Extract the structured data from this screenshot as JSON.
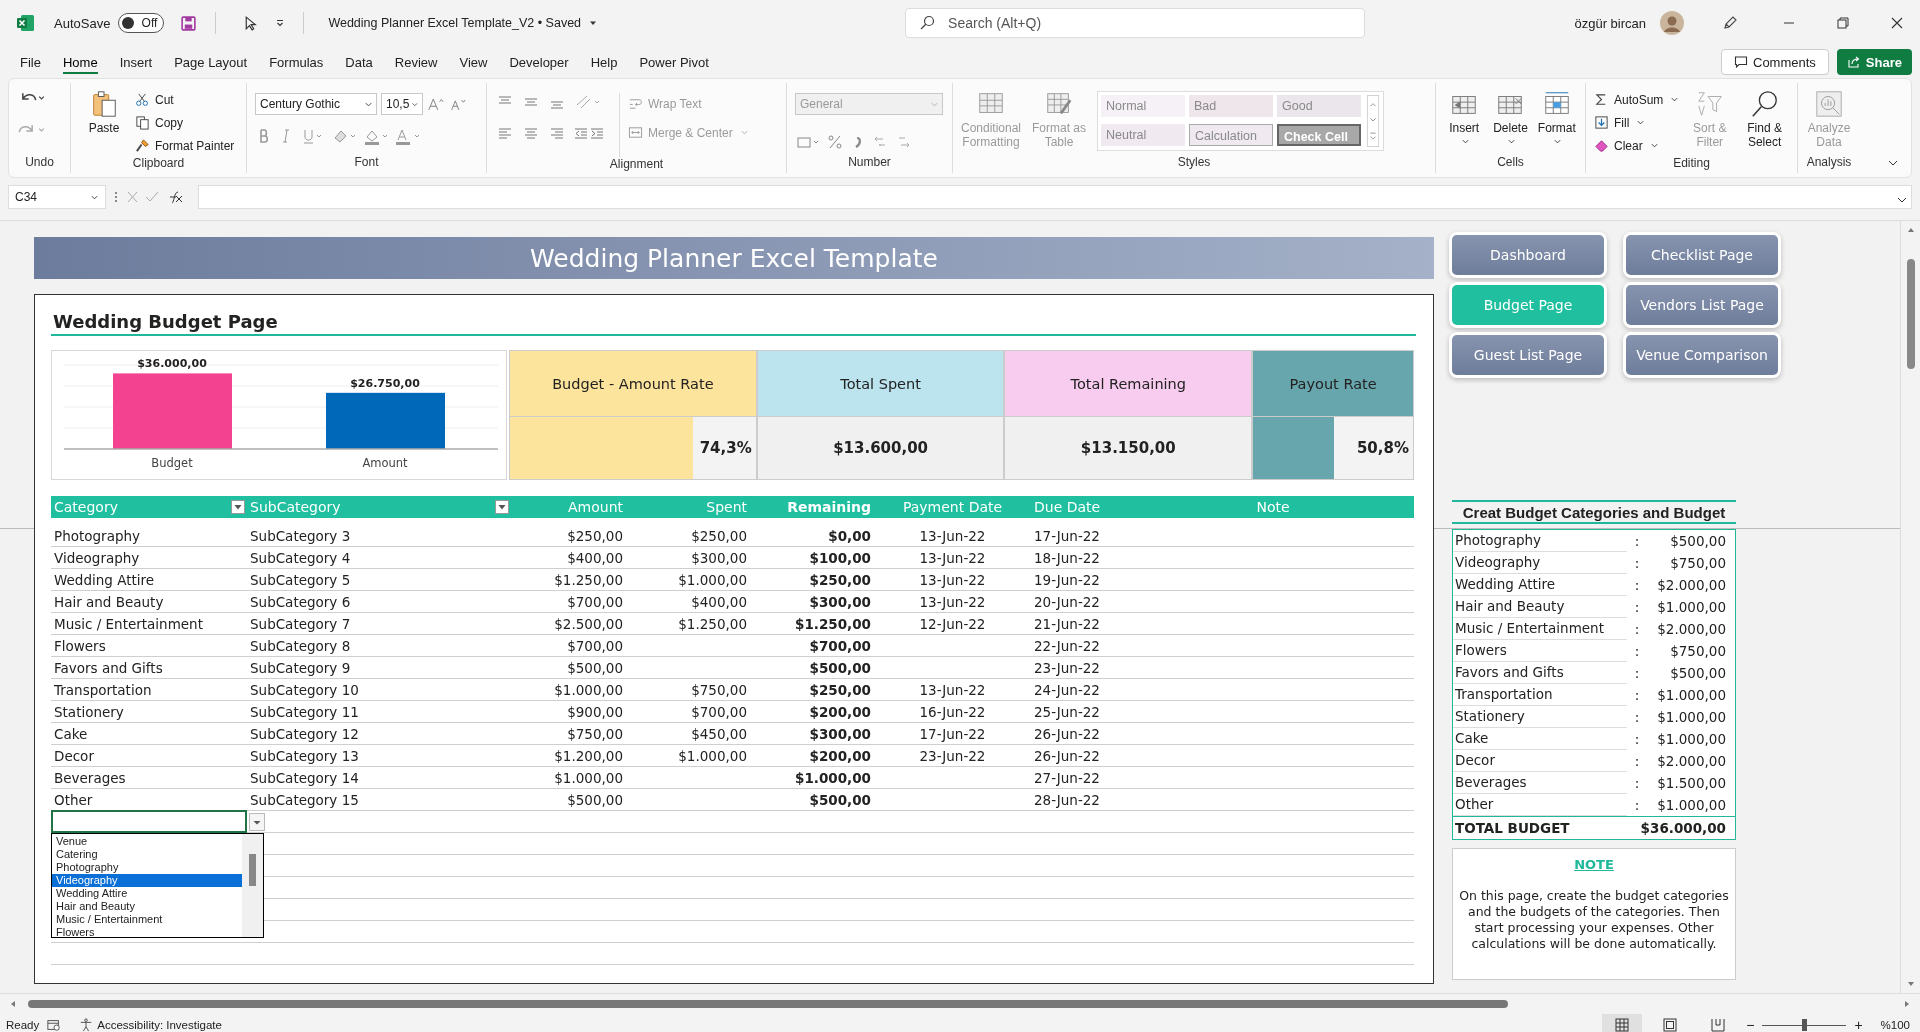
{
  "title_bar": {
    "autosave": {
      "label": "AutoSave",
      "state": "Off",
      "on": false
    },
    "document_title": "Wedding Planner Excel Template_V2 • Saved",
    "search": {
      "placeholder": "Search (Alt+Q)"
    },
    "user_name": "özgür bircan"
  },
  "ribbon_tabs": [
    {
      "label": "File",
      "selected": false
    },
    {
      "label": "Home",
      "selected": true
    },
    {
      "label": "Insert",
      "selected": false
    },
    {
      "label": "Page Layout",
      "selected": false
    },
    {
      "label": "Formulas",
      "selected": false
    },
    {
      "label": "Data",
      "selected": false
    },
    {
      "label": "Review",
      "selected": false
    },
    {
      "label": "View",
      "selected": false
    },
    {
      "label": "Developer",
      "selected": false
    },
    {
      "label": "Help",
      "selected": false
    },
    {
      "label": "Power Pivot",
      "selected": false
    }
  ],
  "comments_button": "Comments",
  "share_button": "Share",
  "ribbon": {
    "undo": {
      "label": "Undo"
    },
    "clipboard": {
      "label": "Clipboard",
      "paste": "Paste",
      "cut": "Cut",
      "copy": "Copy",
      "format_painter": "Format Painter"
    },
    "font": {
      "label": "Font",
      "family": "Century Gothic",
      "size": "10,5"
    },
    "alignment": {
      "label": "Alignment",
      "wrap_text": {
        "label": "Wrap Text",
        "disabled": true
      },
      "merge_center": {
        "label": "Merge & Center",
        "disabled": true
      }
    },
    "number": {
      "label": "Number",
      "format": {
        "label": "General",
        "disabled": true
      }
    },
    "styles": {
      "label": "Styles",
      "conditional_formatting": {
        "label": "Conditional Formatting",
        "disabled": true
      },
      "format_as_table": {
        "label": "Format as Table",
        "disabled": true
      },
      "cell_styles": [
        {
          "label": "Normal",
          "kind": "normal"
        },
        {
          "label": "Bad",
          "kind": "bad"
        },
        {
          "label": "Good",
          "kind": "good"
        },
        {
          "label": "Neutral",
          "kind": "neutral"
        },
        {
          "label": "Calculation",
          "kind": "calculation"
        },
        {
          "label": "Check Cell",
          "kind": "check"
        }
      ]
    },
    "cells": {
      "label": "Cells",
      "buttons": [
        "Insert",
        "Delete",
        "Format"
      ]
    },
    "editing": {
      "label": "Editing",
      "autosum": {
        "label": "AutoSum",
        "disabled": false
      },
      "fill": {
        "label": "Fill",
        "disabled": false
      },
      "clear": {
        "label": "Clear",
        "disabled": false
      },
      "sort_filter": {
        "label": "Sort & Filter",
        "disabled": true
      },
      "find_select": {
        "label": "Find & Select",
        "disabled": false
      }
    },
    "analysis": {
      "label": "Analysis",
      "analyze_data": {
        "label": "Analyze Data",
        "disabled": true
      }
    }
  },
  "formula_bar": {
    "name_box": "C34"
  },
  "sheet": {
    "banner_title": "Wedding Planner Excel Template",
    "nav_buttons": [
      {
        "label": "Dashboard",
        "selected": false
      },
      {
        "label": "Checklist Page",
        "selected": false
      },
      {
        "label": "Budget Page",
        "selected": true
      },
      {
        "label": "Vendors List Page",
        "selected": false
      },
      {
        "label": "Guest List Page",
        "selected": false
      },
      {
        "label": "Venue Comparison",
        "selected": false
      }
    ],
    "section_title": "Wedding Budget Page",
    "budget_chart": {
      "chart_data": {
        "type": "bar",
        "categories": [
          "Budget",
          "Amount"
        ],
        "values": [
          36000,
          26750
        ],
        "colors": [
          "#f3428f",
          "#0068b8"
        ],
        "value_labels": [
          "$36.000,00",
          "$26.750,00"
        ]
      }
    },
    "kpis": [
      {
        "title": "Budget - Amount Rate",
        "kind": "rate",
        "value": "74,3%",
        "level": 0.743,
        "color": "#fde49d"
      },
      {
        "title": "Total Spent",
        "kind": "amount",
        "value": "$13.600,00",
        "color": "#bce4ef"
      },
      {
        "title": "Total Remaining",
        "kind": "amount",
        "value": "$13.150,00",
        "color": "#f8ccee"
      },
      {
        "title": "Payout Rate",
        "kind": "rate",
        "value": "50,8%",
        "level": 0.508,
        "color": "#68a6ae"
      }
    ],
    "table": {
      "columns": [
        {
          "label": "Category",
          "filter": true
        },
        {
          "label": "SubCategory",
          "filter": true
        },
        {
          "label": "Amount",
          "filter": false
        },
        {
          "label": "Spent",
          "filter": false
        },
        {
          "label": "Remaining",
          "filter": false
        },
        {
          "label": "Payment Date",
          "filter": false
        },
        {
          "label": "Due Date",
          "filter": false
        },
        {
          "label": "Note",
          "filter": false
        }
      ],
      "rows": [
        {
          "category": "Photography",
          "subcategory": "SubCategory 3",
          "amount": "$250,00",
          "spent": "$250,00",
          "remaining": "$0,00",
          "payment_date": "13-Jun-22",
          "due_date": "17-Jun-22"
        },
        {
          "category": "Videography",
          "subcategory": "SubCategory 4",
          "amount": "$400,00",
          "spent": "$300,00",
          "remaining": "$100,00",
          "payment_date": "13-Jun-22",
          "due_date": "18-Jun-22"
        },
        {
          "category": "Wedding Attire",
          "subcategory": "SubCategory 5",
          "amount": "$1.250,00",
          "spent": "$1.000,00",
          "remaining": "$250,00",
          "payment_date": "13-Jun-22",
          "due_date": "19-Jun-22"
        },
        {
          "category": "Hair and Beauty",
          "subcategory": "SubCategory 6",
          "amount": "$700,00",
          "spent": "$400,00",
          "remaining": "$300,00",
          "payment_date": "13-Jun-22",
          "due_date": "20-Jun-22"
        },
        {
          "category": "Music / Entertainment",
          "subcategory": "SubCategory 7",
          "amount": "$2.500,00",
          "spent": "$1.250,00",
          "remaining": "$1.250,00",
          "payment_date": "12-Jun-22",
          "due_date": "21-Jun-22"
        },
        {
          "category": "Flowers",
          "subcategory": "SubCategory 8",
          "amount": "$700,00",
          "remaining": "$700,00",
          "due_date": "22-Jun-22"
        },
        {
          "category": "Favors and Gifts",
          "subcategory": "SubCategory 9",
          "amount": "$500,00",
          "remaining": "$500,00",
          "due_date": "23-Jun-22"
        },
        {
          "category": "Transportation",
          "subcategory": "SubCategory 10",
          "amount": "$1.000,00",
          "spent": "$750,00",
          "remaining": "$250,00",
          "payment_date": "13-Jun-22",
          "due_date": "24-Jun-22"
        },
        {
          "category": "Stationery",
          "subcategory": "SubCategory 11",
          "amount": "$900,00",
          "spent": "$700,00",
          "remaining": "$200,00",
          "payment_date": "16-Jun-22",
          "due_date": "25-Jun-22"
        },
        {
          "category": "Cake",
          "subcategory": "SubCategory 12",
          "amount": "$750,00",
          "spent": "$450,00",
          "remaining": "$300,00",
          "payment_date": "17-Jun-22",
          "due_date": "26-Jun-22"
        },
        {
          "category": "Decor",
          "subcategory": "SubCategory 13",
          "amount": "$1.200,00",
          "spent": "$1.000,00",
          "remaining": "$200,00",
          "payment_date": "23-Jun-22",
          "due_date": "26-Jun-22"
        },
        {
          "category": "Beverages",
          "subcategory": "SubCategory 14",
          "amount": "$1.000,00",
          "remaining": "$1.000,00",
          "due_date": "27-Jun-22"
        },
        {
          "category": "Other",
          "subcategory": "SubCategory 15",
          "amount": "$500,00",
          "remaining": "$500,00",
          "due_date": "28-Jun-22"
        }
      ]
    },
    "validation_dropdown": {
      "items": [
        {
          "label": "Venue",
          "selected": false
        },
        {
          "label": "Catering",
          "selected": false
        },
        {
          "label": "Photography",
          "selected": false
        },
        {
          "label": "Videography",
          "selected": true
        },
        {
          "label": "Wedding Attire",
          "selected": false
        },
        {
          "label": "Hair and Beauty",
          "selected": false
        },
        {
          "label": "Music / Entertainment",
          "selected": false
        },
        {
          "label": "Flowers",
          "selected": false
        }
      ]
    },
    "category_budgets": {
      "title": "Creat Budget Categories and Budget",
      "rows": [
        {
          "category": "Photography",
          "separator": ":",
          "amount": "$500,00"
        },
        {
          "category": "Videography",
          "separator": ":",
          "amount": "$750,00"
        },
        {
          "category": "Wedding Attire",
          "separator": ":",
          "amount": "$2.000,00"
        },
        {
          "category": "Hair and Beauty",
          "separator": ":",
          "amount": "$1.000,00"
        },
        {
          "category": "Music / Entertainment",
          "separator": ":",
          "amount": "$2.000,00"
        },
        {
          "category": "Flowers",
          "separator": ":",
          "amount": "$750,00"
        },
        {
          "category": "Favors and Gifts",
          "separator": ":",
          "amount": "$500,00"
        },
        {
          "category": "Transportation",
          "separator": ":",
          "amount": "$1.000,00"
        },
        {
          "category": "Stationery",
          "separator": ":",
          "amount": "$1.000,00"
        },
        {
          "category": "Cake",
          "separator": ":",
          "amount": "$1.000,00"
        },
        {
          "category": "Decor",
          "separator": ":",
          "amount": "$2.000,00"
        },
        {
          "category": "Beverages",
          "separator": ":",
          "amount": "$1.500,00"
        },
        {
          "category": "Other",
          "separator": ":",
          "amount": "$1.000,00"
        }
      ],
      "total": {
        "label": "TOTAL BUDGET",
        "amount": "$36.000,00"
      }
    },
    "note": {
      "title": "NOTE",
      "text": "On this page, create the budget categories and the budgets of the categories. Then start processing your expenses. Other calculations will be done automatically."
    }
  },
  "status_bar": {
    "status": "Ready",
    "accessibility": "Accessibility: Investigate",
    "view_buttons": [
      {
        "kind": "normal",
        "selected": true
      },
      {
        "kind": "layout",
        "selected": false
      },
      {
        "kind": "pagebreak",
        "selected": false
      }
    ],
    "zoom_out": "−",
    "zoom_slider": {
      "level": 0.5
    },
    "zoom_in": "+",
    "zoom": "%100"
  }
}
